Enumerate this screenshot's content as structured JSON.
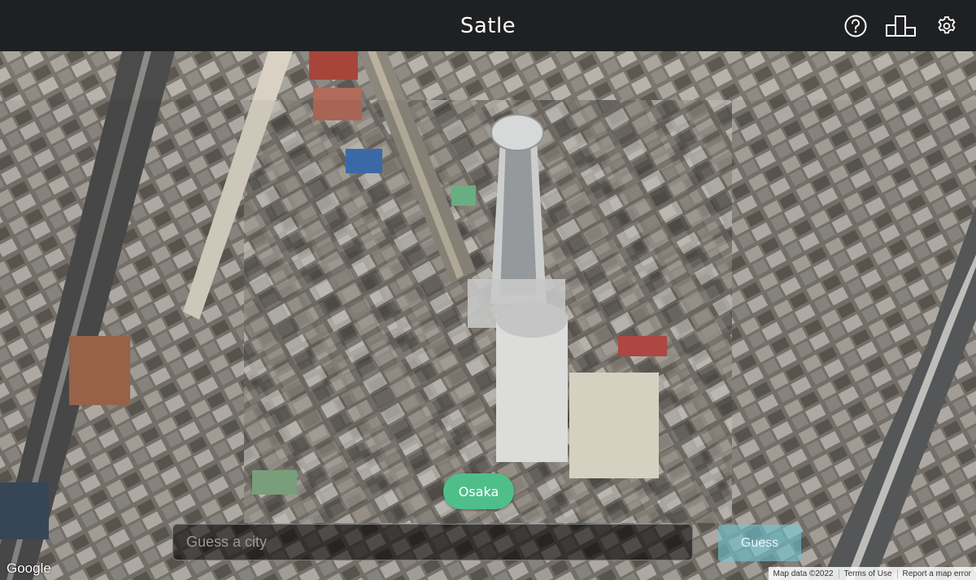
{
  "app": {
    "title": "Satle"
  },
  "toolbar": {
    "help_icon": "help-circle-icon",
    "stats_icon": "bar-chart-icon",
    "settings_icon": "gear-icon"
  },
  "map": {
    "chip_label": "Osaka",
    "provider_logo": "Google",
    "attribution": {
      "data": "Map data ©2022",
      "terms": "Terms of Use",
      "report": "Report a map error"
    }
  },
  "guess": {
    "placeholder": "Guess a city",
    "value": "",
    "button_label": "Guess"
  },
  "colors": {
    "topbar": "#1f2022",
    "chip": "#4fbf8a",
    "guess_button": "#6ec8d7"
  }
}
